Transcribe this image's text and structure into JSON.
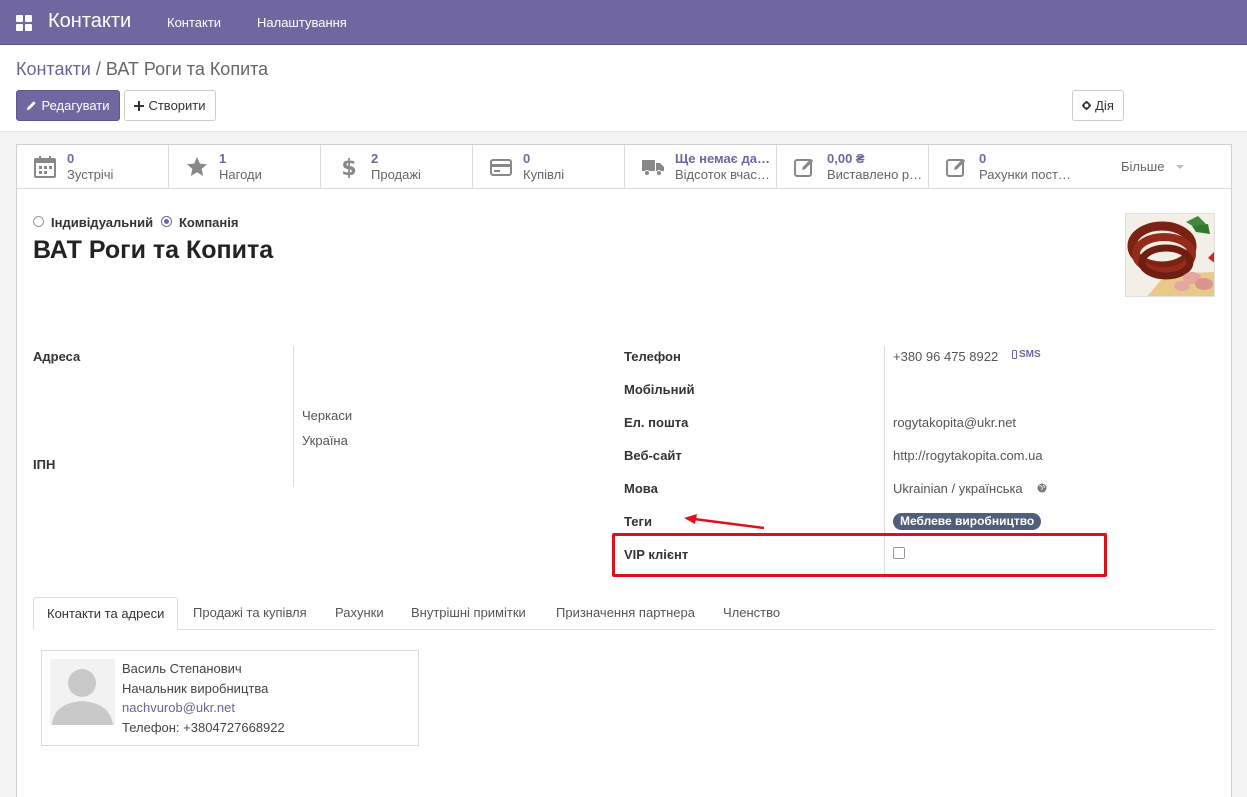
{
  "navbar": {
    "app_title": "Контакти",
    "menu": [
      "Контакти",
      "Налаштування"
    ]
  },
  "control_panel": {
    "breadcrumb_parent": "Контакти",
    "breadcrumb_separator": "/",
    "breadcrumb_current": "ВАТ Роги та Копита",
    "edit_label": "Редагувати",
    "create_label": "Створити",
    "action_label": "Дія"
  },
  "smart_buttons": [
    {
      "icon": "calendar-icon",
      "value": "0",
      "label": "Зустрічі"
    },
    {
      "icon": "star-icon",
      "value": "1",
      "label": "Нагоди"
    },
    {
      "icon": "dollar-icon",
      "value": "2",
      "label": "Продажі"
    },
    {
      "icon": "credit-card-icon",
      "value": "0",
      "label": "Купівлі"
    },
    {
      "icon": "truck-icon",
      "value": "Ще немає дан…",
      "label": "Відсоток вчас…"
    },
    {
      "icon": "edit-icon",
      "value": "0,00 ₴",
      "label": "Виставлено р…"
    },
    {
      "icon": "edit-icon",
      "value": "0",
      "label": "Рахунки пост…"
    }
  ],
  "more_label": "Більше",
  "company_type": {
    "individual_label": "Індивідуальний",
    "company_label": "Компанія",
    "selected": "Компанія"
  },
  "partner_name": "ВАТ Роги та Копита",
  "left_fields": {
    "address_label": "Адреса",
    "address_city": "Черкаси",
    "address_country": "Україна",
    "vat_label": "ІПН"
  },
  "right_fields": {
    "phone_label": "Телефон",
    "phone_value": "+380 96 475 8922",
    "sms_label": "SMS",
    "mobile_label": "Мобільний",
    "email_label": "Ел. пошта",
    "email_value": "rogytakopita@ukr.net",
    "website_label": "Веб-сайт",
    "website_value": "http://rogytakopita.com.ua",
    "language_label": "Мова",
    "language_value": "Ukrainian / українська",
    "tags_label": "Теги",
    "tag_value": "Меблеве виробництво",
    "vip_label": "VIP клієнт",
    "vip_checked": false
  },
  "tabs": [
    "Контакти та адреси",
    "Продажі та купівля",
    "Рахунки",
    "Внутрішні примітки",
    "Призначення партнера",
    "Членство"
  ],
  "active_tab": "Контакти та адреси",
  "contact_card": {
    "name": "Василь Степанович",
    "function": "Начальник виробництва",
    "email": "nachvurob@ukr.net",
    "phone": "Телефон: +3804727668922"
  },
  "colors": {
    "brand": "#7066a0",
    "highlight": "#e0101a",
    "tag_bg": "#4f5f7a"
  }
}
